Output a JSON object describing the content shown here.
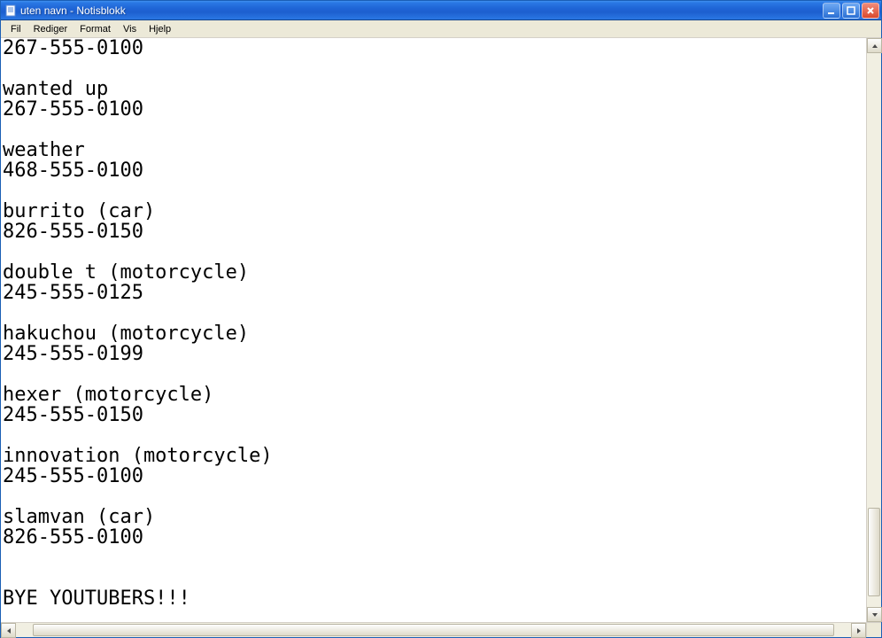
{
  "window": {
    "title": "uten navn - Notisblokk"
  },
  "menubar": {
    "items": [
      "Fil",
      "Rediger",
      "Format",
      "Vis",
      "Hjelp"
    ]
  },
  "editor": {
    "text": "267-555-0100\n\nwanted up\n267-555-0100\n\nweather\n468-555-0100\n\nburrito (car)\n826-555-0150\n\ndouble t (motorcycle)\n245-555-0125\n\nhakuchou (motorcycle)\n245-555-0199\n\nhexer (motorcycle)\n245-555-0150\n\ninnovation (motorcycle)\n245-555-0100\n\nslamvan (car)\n826-555-0100\n\n\nBYE YOUTUBERS!!!"
  },
  "vscroll": {
    "thumb_top_pct": 82,
    "thumb_height_pct": 16
  },
  "hscroll": {
    "thumb_left_pct": 2,
    "thumb_width_pct": 96
  }
}
